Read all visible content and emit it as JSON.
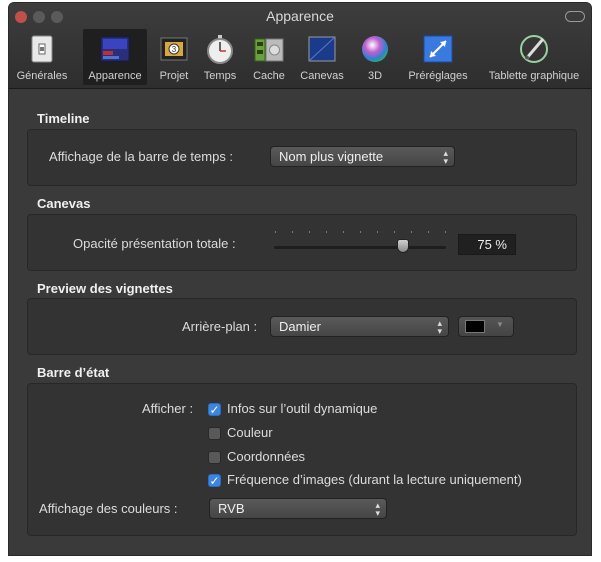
{
  "window": {
    "title": "Apparence"
  },
  "toolbar": {
    "items": [
      {
        "label": "Générales",
        "icon": "switch-icon"
      },
      {
        "label": "Apparence",
        "icon": "appearance-icon"
      },
      {
        "label": "Projet",
        "icon": "film-icon"
      },
      {
        "label": "Temps",
        "icon": "stopwatch-icon"
      },
      {
        "label": "Cache",
        "icon": "cache-icon"
      },
      {
        "label": "Canevas",
        "icon": "canvas-icon"
      },
      {
        "label": "3D",
        "icon": "sphere-icon"
      },
      {
        "label": "Préréglages",
        "icon": "presets-icon"
      },
      {
        "label": "Tablette graphique",
        "icon": "pen-icon"
      }
    ],
    "selected": "Apparence"
  },
  "timeline": {
    "title": "Timeline",
    "label": "Affichage de la barre de temps :",
    "value": "Nom plus vignette"
  },
  "canevas": {
    "title": "Canevas",
    "label": "Opacité présentation totale :",
    "opacity_fraction": 0.75,
    "value": "75 %"
  },
  "preview": {
    "title": "Preview des vignettes",
    "label": "Arrière-plan :",
    "value": "Damier",
    "swatch_color": "#000000"
  },
  "barre": {
    "title": "Barre d’état",
    "afficher_label": "Afficher :",
    "options": [
      {
        "label": "Infos sur l’outil dynamique",
        "checked": true
      },
      {
        "label": "Couleur",
        "checked": false
      },
      {
        "label": "Coordonnées",
        "checked": false
      },
      {
        "label": "Fréquence d’images (durant la lecture uniquement)",
        "checked": true
      }
    ],
    "couleurs_label": "Affichage des couleurs :",
    "couleurs_value": "RVB"
  },
  "colors": {
    "accent": "#3b86e0",
    "background": "#3a3a3a"
  }
}
